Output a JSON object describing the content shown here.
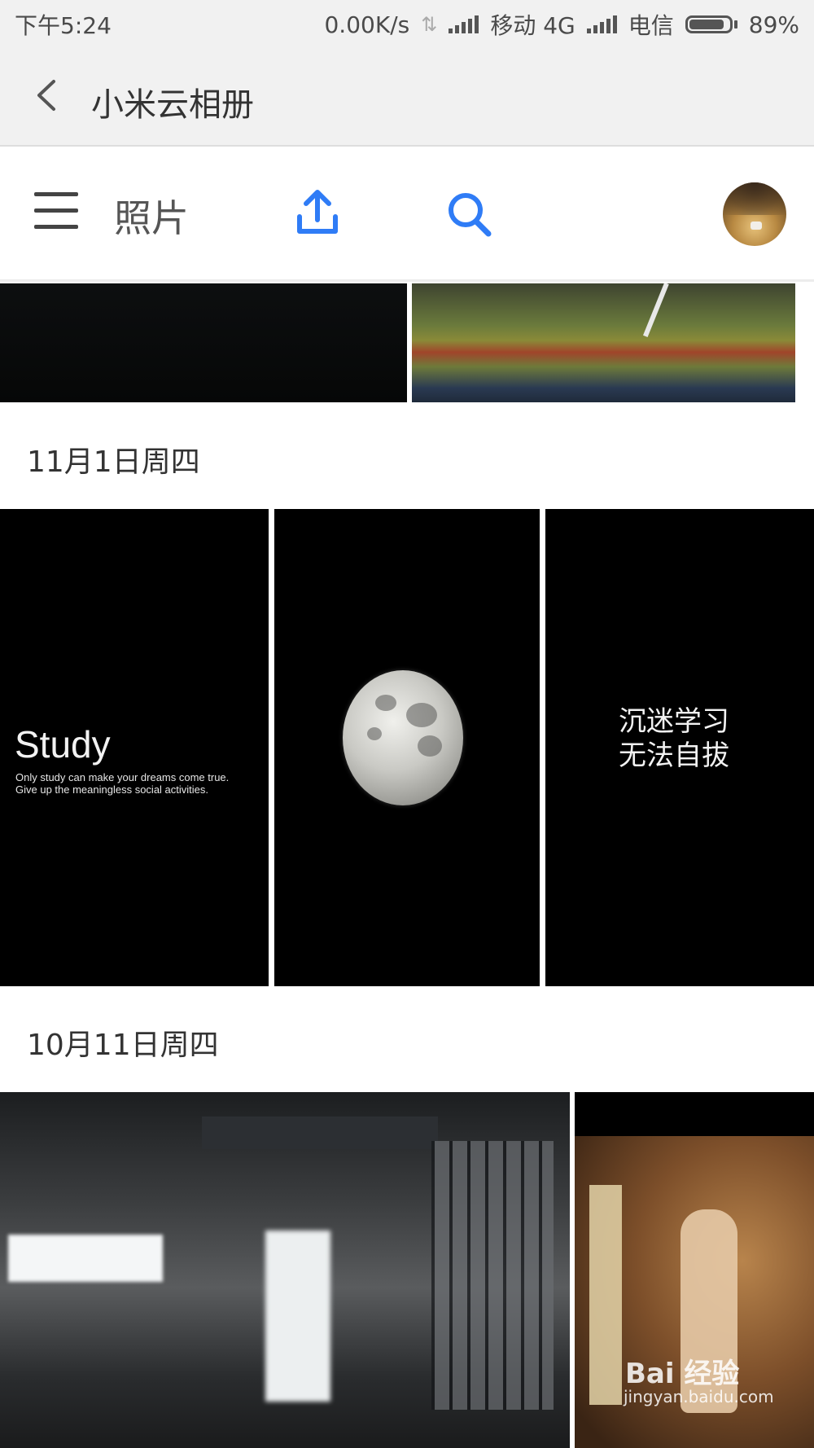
{
  "status_bar": {
    "time": "下午5:24",
    "network_speed": "0.00K/s",
    "carrier1": "移动 4G",
    "carrier2": "电信",
    "battery_text": "89%",
    "battery_level": 0.89
  },
  "header": {
    "title": "小米云相册",
    "back_icon": "chevron-left-icon"
  },
  "toolbar": {
    "label": "照片",
    "menu_icon": "hamburger-menu-icon",
    "upload_icon": "upload-icon",
    "search_icon": "search-icon",
    "accent_color": "#2f7cf6"
  },
  "sections": [
    {
      "date": "11月1日周四",
      "photos": [
        {
          "title": "Study",
          "subtitle_lines": [
            "Only study can make your dreams come true.",
            "Give up the meaningless social activities."
          ]
        },
        {
          "title": ""
        },
        {
          "lines": [
            "沉迷学习",
            "无法自拔"
          ]
        }
      ]
    },
    {
      "date": "10月11日周四",
      "photos": [
        {
          "title": ""
        },
        {
          "watermark": "Bai 经验",
          "watermark_url": "jingyan.baidu.com"
        }
      ]
    }
  ]
}
